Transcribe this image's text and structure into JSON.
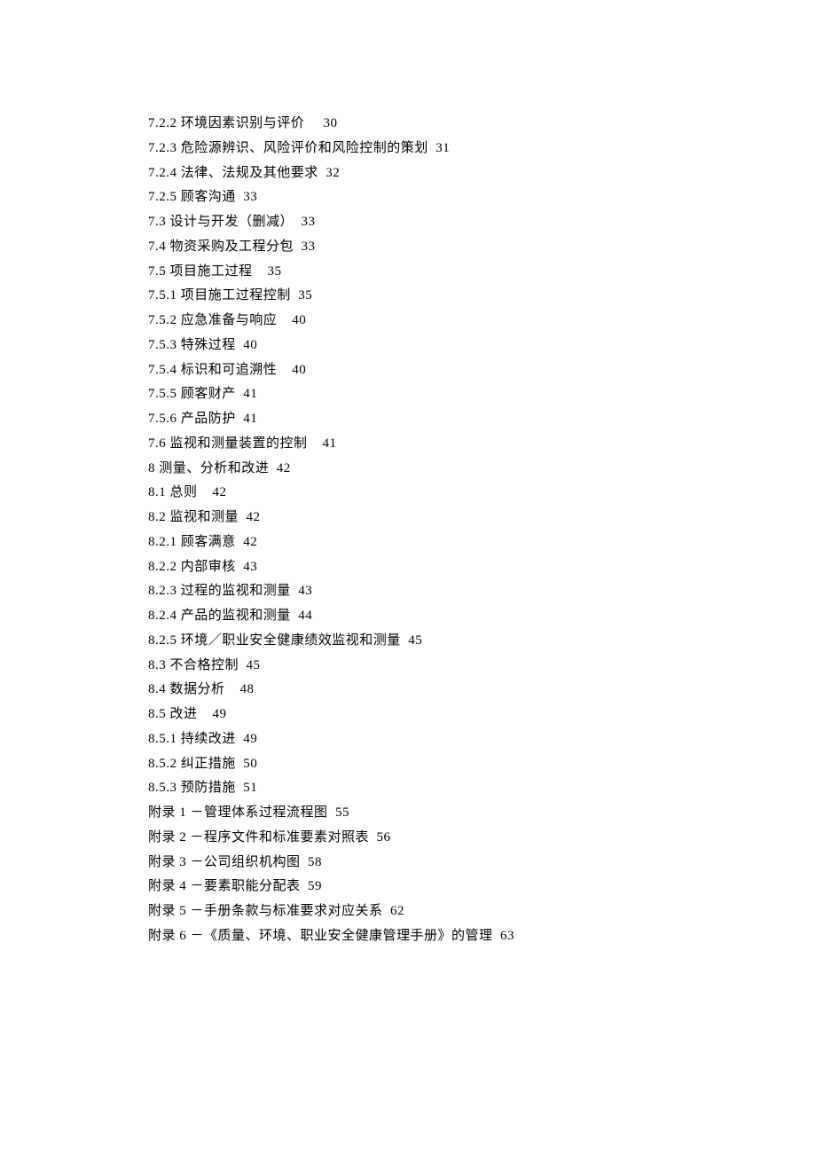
{
  "toc": [
    {
      "section": "7.2.2",
      "title": "环境因素识别与评价",
      "gap": "     ",
      "page": "30"
    },
    {
      "section": "7.2.3",
      "title": "危险源辨识、风险评价和风险控制的策划",
      "gap": "  ",
      "page": "31"
    },
    {
      "section": "7.2.4",
      "title": "法律、法规及其他要求",
      "gap": "  ",
      "page": "32"
    },
    {
      "section": "7.2.5",
      "title": "顾客沟通",
      "gap": "  ",
      "page": "33"
    },
    {
      "section": "7.3",
      "title": "设计与开发（删减）",
      "gap": "  ",
      "page": "33"
    },
    {
      "section": "7.4",
      "title": "物资采购及工程分包",
      "gap": "  ",
      "page": "33"
    },
    {
      "section": "7.5",
      "title": "项目施工过程",
      "gap": "    ",
      "page": "35"
    },
    {
      "section": "7.5.1",
      "title": "项目施工过程控制",
      "gap": "  ",
      "page": "35"
    },
    {
      "section": "7.5.2",
      "title": "应急准备与响应",
      "gap": "    ",
      "page": "40"
    },
    {
      "section": "7.5.3",
      "title": "特殊过程",
      "gap": "  ",
      "page": "40"
    },
    {
      "section": "7.5.4",
      "title": "标识和可追溯性",
      "gap": "    ",
      "page": "40"
    },
    {
      "section": "7.5.5",
      "title": "顾客财产",
      "gap": "  ",
      "page": "41"
    },
    {
      "section": "7.5.6",
      "title": "产品防护",
      "gap": "  ",
      "page": "41"
    },
    {
      "section": "7.6",
      "title": "监视和测量装置的控制",
      "gap": "    ",
      "page": "41"
    },
    {
      "section": "8",
      "title": "测量、分析和改进",
      "gap": "  ",
      "page": "42"
    },
    {
      "section": "8.1",
      "title": "总则",
      "gap": "    ",
      "page": "42"
    },
    {
      "section": "8.2",
      "title": "监视和测量",
      "gap": "  ",
      "page": "42"
    },
    {
      "section": "8.2.1",
      "title": "顾客满意",
      "gap": "  ",
      "page": "42"
    },
    {
      "section": "8.2.2",
      "title": "内部审核",
      "gap": "  ",
      "page": "43"
    },
    {
      "section": "8.2.3",
      "title": "过程的监视和测量",
      "gap": "  ",
      "page": "43"
    },
    {
      "section": "8.2.4",
      "title": "产品的监视和测量",
      "gap": "  ",
      "page": "44"
    },
    {
      "section": "8.2.5",
      "title": "环境／职业安全健康绩效监视和测量",
      "gap": "  ",
      "page": "45"
    },
    {
      "section": "8.3",
      "title": "不合格控制",
      "gap": "  ",
      "page": "45"
    },
    {
      "section": "8.4",
      "title": "数据分析",
      "gap": "    ",
      "page": "48"
    },
    {
      "section": "8.5",
      "title": "改进",
      "gap": "    ",
      "page": "49"
    },
    {
      "section": "8.5.1",
      "title": "持续改进",
      "gap": "  ",
      "page": "49"
    },
    {
      "section": "8.5.2",
      "title": "纠正措施",
      "gap": "  ",
      "page": "50"
    },
    {
      "section": "8.5.3",
      "title": "预防措施",
      "gap": "  ",
      "page": "51"
    },
    {
      "section": "附录 1",
      "title": "－管理体系过程流程图",
      "gap": "  ",
      "page": "55"
    },
    {
      "section": "附录 2",
      "title": "－程序文件和标准要素对照表",
      "gap": "  ",
      "page": "56"
    },
    {
      "section": "附录 3",
      "title": "－公司组织机构图",
      "gap": "  ",
      "page": "58"
    },
    {
      "section": "附录 4",
      "title": "－要素职能分配表",
      "gap": "  ",
      "page": "59"
    },
    {
      "section": "附录 5",
      "title": "－手册条款与标准要求对应关系",
      "gap": "  ",
      "page": "62"
    },
    {
      "section": "附录 6",
      "title": "－《质量、环境、职业安全健康管理手册》的管理",
      "gap": "  ",
      "page": "63"
    }
  ]
}
